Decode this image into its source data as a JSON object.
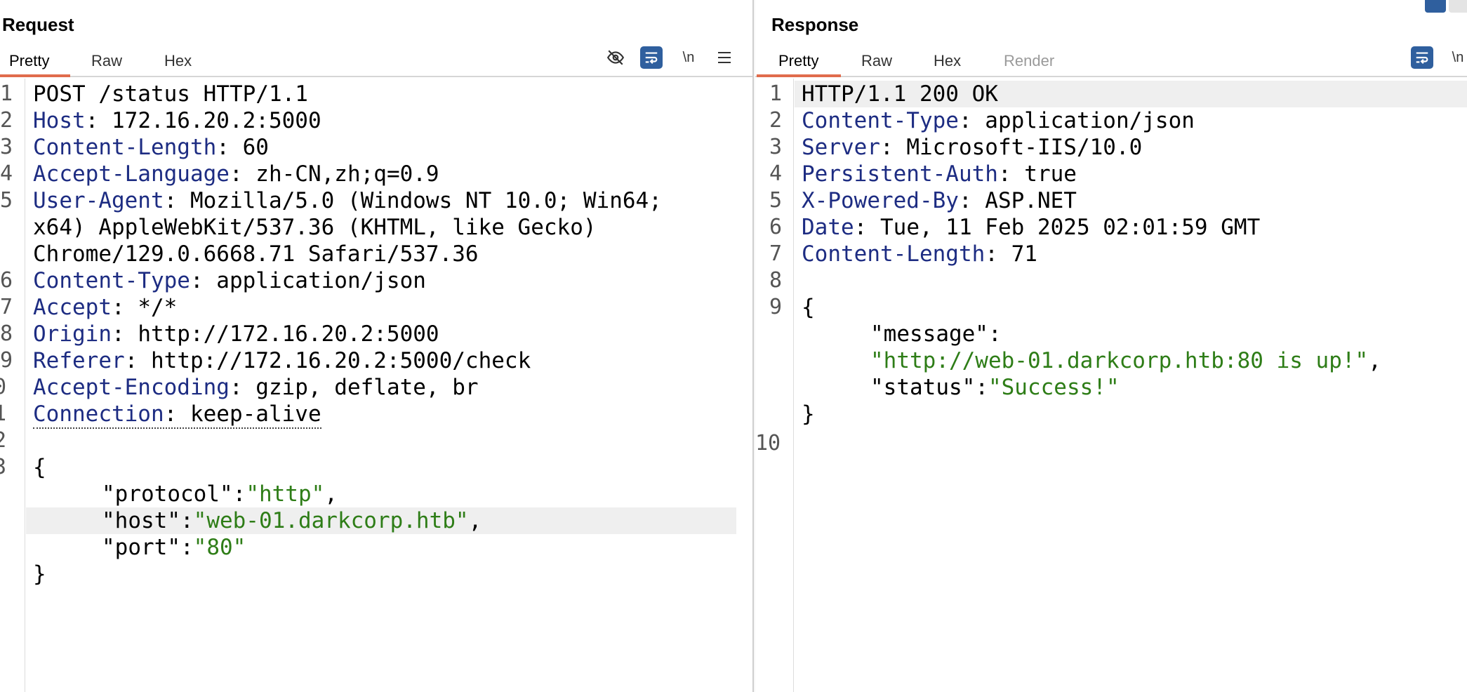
{
  "request": {
    "title": "Request",
    "tabs": [
      "Pretty",
      "Raw",
      "Hex"
    ],
    "toolbar": {
      "hide_icon": "eye-slash-icon",
      "wrap_icon": "wrap-lines-icon",
      "newline_label": "\\n",
      "menu_icon": "hamburger-menu-icon"
    },
    "line_numbers": [
      "1",
      "2",
      "3",
      "4",
      "5",
      "6",
      "7",
      "8",
      "9",
      "0",
      "1",
      "2",
      "3"
    ],
    "lines": {
      "l1": "POST /status HTTP/1.1",
      "l2_name": "Host",
      "l2_value": " 172.16.20.2:5000",
      "l3_name": "Content-Length",
      "l3_value": " 60",
      "l4_name": "Accept-Language",
      "l4_value": " zh-CN,zh;q=0.9",
      "l5_name": "User-Agent",
      "l5_value": " Mozilla/5.0 (Windows NT 10.0; Win64;",
      "l5_cont1": "x64) AppleWebKit/537.36 (KHTML, like Gecko)",
      "l5_cont2": "Chrome/129.0.6668.71 Safari/537.36",
      "l6_name": "Content-Type",
      "l6_value": " application/json",
      "l7_name": "Accept",
      "l7_value": " */*",
      "l8_name": "Origin",
      "l8_value": " http://172.16.20.2:5000",
      "l9_name": "Referer",
      "l9_value": " http://172.16.20.2:5000/check",
      "l10_name": "Accept-Encoding",
      "l10_value": " gzip, deflate, br",
      "l11_name": "Connection",
      "l11_value": " keep-alive",
      "brace_open": "{",
      "k_protocol": "\"protocol\"",
      "v_protocol": "\"http\"",
      "k_host": "\"host\"",
      "v_host": "\"web-01.darkcorp.htb\"",
      "k_port": "\"port\"",
      "v_port": "\"80\"",
      "brace_close": "}"
    }
  },
  "response": {
    "title": "Response",
    "tabs": [
      "Pretty",
      "Raw",
      "Hex",
      "Render"
    ],
    "toolbar": {
      "wrap_icon": "wrap-lines-icon",
      "newline_label": "\\n"
    },
    "line_numbers": [
      "1",
      "2",
      "3",
      "4",
      "5",
      "6",
      "7",
      "8",
      "9",
      "10"
    ],
    "lines": {
      "l1": "HTTP/1.1 200 OK",
      "l2_name": "Content-Type",
      "l2_value": " application/json",
      "l3_name": "Server",
      "l3_value": " Microsoft-IIS/10.0",
      "l4_name": "Persistent-Auth",
      "l4_value": " true",
      "l5_name": "X-Powered-By",
      "l5_value": " ASP.NET",
      "l6_name": "Date",
      "l6_value": " Tue, 11 Feb 2025 02:01:59 GMT",
      "l7_name": "Content-Length",
      "l7_value": " 71",
      "brace_open": "{",
      "k_message": "\"message\"",
      "v_message": "\"http://web-01.darkcorp.htb:80 is up!\"",
      "k_status": "\"status\"",
      "v_status": "\"Success!\"",
      "brace_close": "}"
    }
  },
  "colors": {
    "header_name": "#1d2c82",
    "json_string": "#2e7d17",
    "tab_underline": "#e06c4c",
    "toggle_on": "#2f5f9e"
  }
}
